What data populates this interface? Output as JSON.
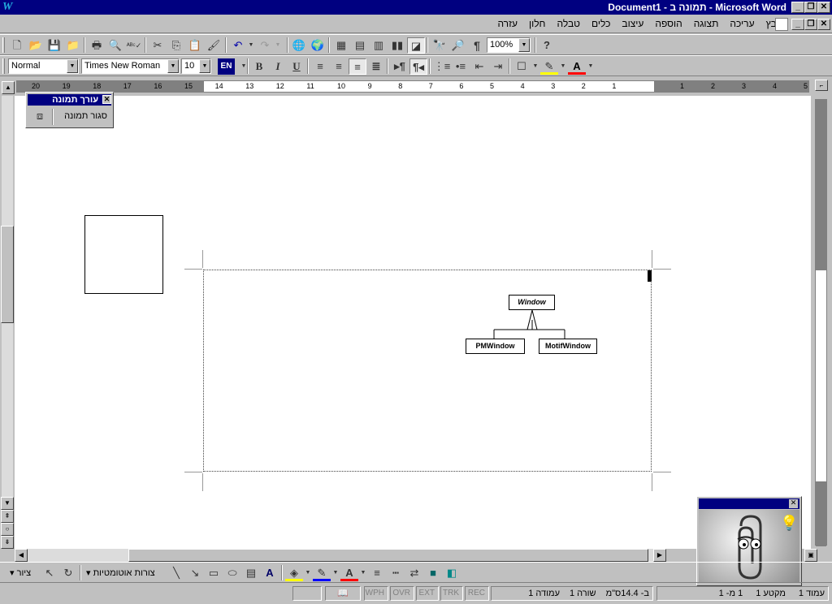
{
  "window": {
    "title": "Document1 - תמונה ב - Microsoft Word"
  },
  "menu": {
    "items": [
      "קובץ",
      "עריכה",
      "תצוגה",
      "הוספה",
      "עיצוב",
      "כלים",
      "טבלה",
      "חלון",
      "עזרה"
    ]
  },
  "format": {
    "style": "Normal",
    "font": "Times New Roman",
    "size": "10",
    "lang": "EN",
    "zoom": "100%"
  },
  "ruler": {
    "left_numbers": [
      "20",
      "19",
      "18",
      "17",
      "16",
      "15",
      "14",
      "13",
      "12",
      "11",
      "10",
      "9",
      "8",
      "7",
      "6",
      "5",
      "4",
      "3",
      "2",
      "1"
    ],
    "right_numbers": [
      "1",
      "2",
      "3",
      "4",
      "5"
    ]
  },
  "float_toolbar": {
    "title": "עורך תמונה",
    "close_label": "סגור תמונה"
  },
  "diagram": {
    "parent": "Window",
    "children": [
      "PMWindow",
      "MotifWindow"
    ]
  },
  "drawing": {
    "draw_label": "ציור",
    "autoshapes_label": "צורות אוטומטיות"
  },
  "status": {
    "page": "עמוד 1",
    "section": "מקטע 1",
    "pages": "1 מ- 1",
    "position": "ב- 14.4ס\"מ",
    "line": "שורה 1",
    "column": "עמודה 1",
    "rec": "REC",
    "trk": "TRK",
    "ext": "EXT",
    "ovr": "OVR",
    "wph": "WPH"
  },
  "colors": {
    "titlebar": "#000080",
    "face": "#c0c0c0"
  }
}
